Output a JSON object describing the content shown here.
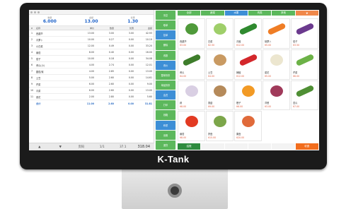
{
  "device": {
    "brand": "K-Tank"
  },
  "left_panel": {
    "summary": [
      {
        "label": "数量",
        "value": "6.000"
      },
      {
        "label": "金额",
        "value": "13.00"
      },
      {
        "label": "优惠",
        "value": "1.30"
      }
    ],
    "columns": [
      "#",
      "名称",
      "单价",
      "数量",
      "优惠",
      "金额"
    ],
    "rows": [
      {
        "idx": "1",
        "name": "西葫芦",
        "a": "13.00",
        "b": "3.00",
        "c": "3.00",
        "d": "42.93"
      },
      {
        "idx": "2",
        "name": "青萝卜",
        "a": "10.00",
        "b": "0.27",
        "c": "0.00",
        "d": "10.19"
      },
      {
        "idx": "3",
        "name": "小白菜",
        "a": "12.00",
        "b": "0.49",
        "c": "0.00",
        "d": "33.20"
      },
      {
        "idx": "4",
        "name": "番茄",
        "a": "8.00",
        "b": "0.40",
        "c": "0.00",
        "d": "16.00"
      },
      {
        "idx": "5",
        "name": "茄子",
        "a": "10.00",
        "b": "0.18",
        "c": "0.00",
        "d": "34.08"
      },
      {
        "idx": "6",
        "name": "黄瓜(小)",
        "a": "4.00",
        "b": "2.74",
        "c": "0.00",
        "d": "12.01"
      },
      {
        "idx": "7",
        "name": "圆茄/紫",
        "a": "4.00",
        "b": "2.85",
        "c": "0.00",
        "d": "13.00"
      },
      {
        "idx": "8",
        "name": "土豆",
        "a": "5.00",
        "b": "2.60",
        "c": "0.00",
        "d": "14.61"
      },
      {
        "idx": "9",
        "name": "芹菜",
        "a": "6.00",
        "b": "2.60",
        "c": "0.00",
        "d": "9.00"
      },
      {
        "idx": "10",
        "name": "青菜",
        "a": "6.00",
        "b": "2.60",
        "c": "0.00",
        "d": "13.00"
      },
      {
        "idx": "11",
        "name": "菜花",
        "a": "2.00",
        "b": "2.80",
        "c": "0.00",
        "d": "5.60"
      },
      {
        "idx": "",
        "name": "合计",
        "a": "11.00",
        "b": "2.60",
        "c": "0.00",
        "d": "31.81"
      }
    ],
    "pager": {
      "prev": "▲",
      "next": "▼",
      "label": "页码",
      "page": "1/1",
      "count": "37.1",
      "total": "318.04"
    }
  },
  "middle_buttons": [
    "清空",
    "取单",
    "挂单",
    "删除",
    "改数",
    "改价",
    "整单折扣",
    "单品折扣",
    "会员",
    "打印",
    "钱箱",
    "称重",
    "设置",
    "退货"
  ],
  "right_panel": {
    "categories": [
      "全部",
      "蔬菜",
      "水果",
      "肉类",
      "其他",
      "▼"
    ],
    "products": [
      {
        "name": "西葫芦",
        "price": "¥3.00",
        "color": "#4f9a3a",
        "shape": "round"
      },
      {
        "name": "白菜",
        "price": "¥2.50",
        "color": "#9fcf6a",
        "shape": "round"
      },
      {
        "name": "青椒",
        "price": "¥12.00",
        "color": "#2f8a2f",
        "shape": "long"
      },
      {
        "name": "胡萝卜",
        "price": "¥5.00",
        "color": "#ef7d25",
        "shape": "long"
      },
      {
        "name": "茄子",
        "price": "¥3.50",
        "color": "#6b3a8e",
        "shape": "long"
      },
      {
        "name": "黄瓜",
        "price": "¥4.00",
        "color": "#3e7d2b",
        "shape": "long"
      },
      {
        "name": "土豆",
        "price": "¥4.00",
        "color": "#c99a62",
        "shape": "round"
      },
      {
        "name": "辣椒",
        "price": "¥12.00",
        "color": "#d3272b",
        "shape": "long"
      },
      {
        "name": "菜花",
        "price": "¥5.00",
        "color": "#ece6cf",
        "shape": "round"
      },
      {
        "name": "芹菜",
        "price": "¥6.00",
        "color": "#6cb247",
        "shape": "long"
      },
      {
        "name": "蒜",
        "price": "¥8.00",
        "color": "#d9cfe3",
        "shape": "round"
      },
      {
        "name": "香菇",
        "price": "¥9.00",
        "color": "#b58a5a",
        "shape": "round"
      },
      {
        "name": "橙子",
        "price": "¥6.00",
        "color": "#f29a25",
        "shape": "round"
      },
      {
        "name": "洋葱",
        "price": "¥3.00",
        "color": "#a03a5a",
        "shape": "round"
      },
      {
        "name": "苦瓜",
        "price": "¥7.00",
        "color": "#4f8f34",
        "shape": "long"
      },
      {
        "name": "番茄",
        "price": "¥8.00",
        "color": "#e23a22",
        "shape": "round"
      },
      {
        "name": "拼盘",
        "price": "¥15.00",
        "color": "#7ca64a",
        "shape": "round"
      },
      {
        "name": "果盘",
        "price": "¥20.00",
        "color": "#e06a3a",
        "shape": "round"
      }
    ],
    "footer": [
      "结账",
      "",
      "",
      "",
      "",
      "收银"
    ]
  }
}
